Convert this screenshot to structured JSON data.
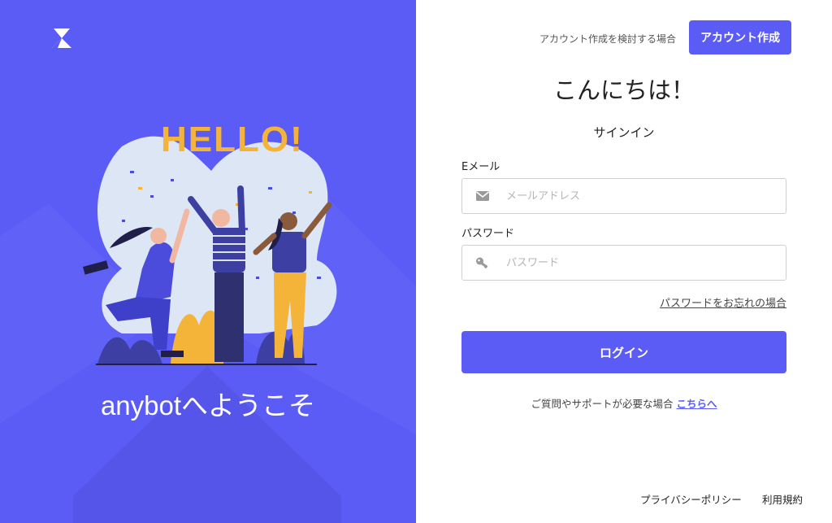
{
  "brand": {
    "name": "anybot",
    "welcome": "anybotへようこそ",
    "accent": "#5b5cf5"
  },
  "illustration": {
    "text": "HELLO!"
  },
  "header": {
    "signup_prompt": "アカウント作成を検討する場合",
    "signup_button": "アカウント作成"
  },
  "form": {
    "greeting": "こんにちは！",
    "subtitle": "サインイン",
    "email_label": "Eメール",
    "email_placeholder": "メールアドレス",
    "email_icon": "envelope-icon",
    "password_label": "パスワード",
    "password_placeholder": "パスワード",
    "password_icon": "key-icon",
    "forgot_link": "パスワードをお忘れの場合",
    "login_button": "ログイン",
    "help_text": "ご質問やサポートが必要な場合",
    "help_link": "こちらへ"
  },
  "footer": {
    "privacy": "プライバシーポリシー",
    "terms": "利用規約"
  }
}
